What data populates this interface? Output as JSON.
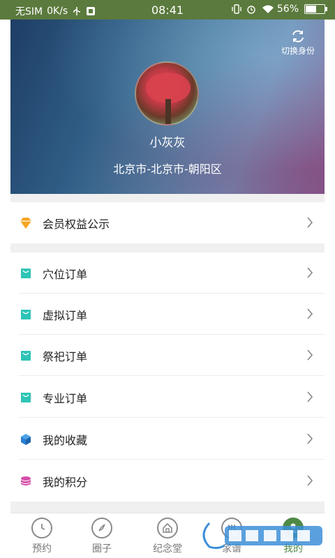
{
  "status_bar": {
    "carrier": "无SIM",
    "speed": "0K/s",
    "time": "08:41",
    "battery": "56%",
    "battery_level": 0.56,
    "icons": [
      "usb-icon",
      "notification-icon",
      "vibrate-icon",
      "alarm-icon",
      "wifi-icon",
      "battery-icon"
    ]
  },
  "header": {
    "switch_label": "切换身份",
    "name": "小灰灰",
    "location": "北京市-北京市-朝阳区"
  },
  "menu": {
    "member": {
      "label": "会员权益公示",
      "icon": "diamond-icon",
      "color": "#f5a623"
    },
    "items": [
      {
        "label": "穴位订单",
        "icon": "shopping-bag-icon",
        "color": "#2ec4b6"
      },
      {
        "label": "虚拟订单",
        "icon": "shopping-bag-icon",
        "color": "#2ec4b6"
      },
      {
        "label": "祭祀订单",
        "icon": "shopping-bag-icon",
        "color": "#2ec4b6"
      },
      {
        "label": "专业订单",
        "icon": "shopping-bag-icon",
        "color": "#2ec4b6"
      },
      {
        "label": "我的收藏",
        "icon": "cube-icon",
        "color": "#2a7fd4"
      },
      {
        "label": "我的积分",
        "icon": "coins-icon",
        "color": "#d64fa8"
      }
    ]
  },
  "tabbar": {
    "tabs": [
      {
        "label": "预约",
        "icon": "clock-icon"
      },
      {
        "label": "圈子",
        "icon": "compass-icon"
      },
      {
        "label": "纪念堂",
        "icon": "home-icon"
      },
      {
        "label": "家谱",
        "icon": "family-tree-icon"
      },
      {
        "label": "我的",
        "icon": "user-icon",
        "active": true
      }
    ],
    "accent": "#4f8a45"
  }
}
